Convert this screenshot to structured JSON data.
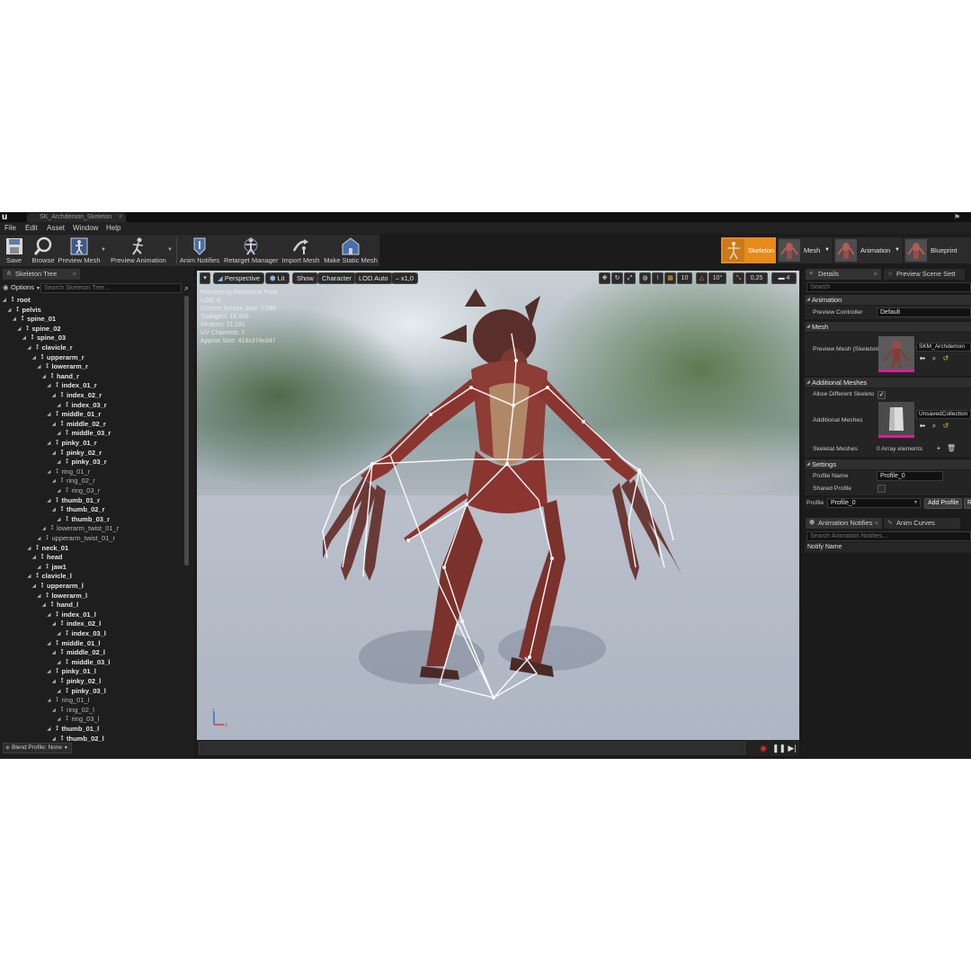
{
  "window": {
    "doc_tab": "SK_Archdemon_Skeleton"
  },
  "menu": [
    "File",
    "Edit",
    "Asset",
    "Window",
    "Help"
  ],
  "toolbar": {
    "save": "Save",
    "browse": "Browse",
    "preview_mesh": "Preview Mesh",
    "preview_animation": "Preview Animation",
    "anim_notifies": "Anim Notifies",
    "retarget_manager": "Retarget Manager",
    "import_mesh": "Import Mesh",
    "make_static_mesh": "Make Static Mesh"
  },
  "modes": {
    "skeleton": "Skeleton",
    "mesh": "Mesh",
    "animation": "Animation",
    "blueprint": "Blueprint"
  },
  "skeleton_tree": {
    "tab": "Skeleton Tree",
    "options": "Options",
    "search_placeholder": "Search Skeleton Tree...",
    "blend_profile": "Blend Profile: None",
    "bones": [
      {
        "name": "root",
        "depth": 0
      },
      {
        "name": "pelvis",
        "depth": 1
      },
      {
        "name": "spine_01",
        "depth": 2
      },
      {
        "name": "spine_02",
        "depth": 3
      },
      {
        "name": "spine_03",
        "depth": 4
      },
      {
        "name": "clavicle_r",
        "depth": 5
      },
      {
        "name": "upperarm_r",
        "depth": 6
      },
      {
        "name": "lowerarm_r",
        "depth": 7
      },
      {
        "name": "hand_r",
        "depth": 8
      },
      {
        "name": "index_01_r",
        "depth": 9
      },
      {
        "name": "index_02_r",
        "depth": 10
      },
      {
        "name": "index_03_r",
        "depth": 11
      },
      {
        "name": "middle_01_r",
        "depth": 9
      },
      {
        "name": "middle_02_r",
        "depth": 10
      },
      {
        "name": "middle_03_r",
        "depth": 11
      },
      {
        "name": "pinky_01_r",
        "depth": 9
      },
      {
        "name": "pinky_02_r",
        "depth": 10
      },
      {
        "name": "pinky_03_r",
        "depth": 11
      },
      {
        "name": "ring_01_r",
        "depth": 9
      },
      {
        "name": "ring_02_r",
        "depth": 10
      },
      {
        "name": "ring_03_r",
        "depth": 11
      },
      {
        "name": "thumb_01_r",
        "depth": 9
      },
      {
        "name": "thumb_02_r",
        "depth": 10
      },
      {
        "name": "thumb_03_r",
        "depth": 11
      },
      {
        "name": "lowerarm_twist_01_r",
        "depth": 8
      },
      {
        "name": "upperarm_twist_01_r",
        "depth": 7
      },
      {
        "name": "neck_01",
        "depth": 5
      },
      {
        "name": "head",
        "depth": 6
      },
      {
        "name": "jaw1",
        "depth": 7
      },
      {
        "name": "clavicle_l",
        "depth": 5
      },
      {
        "name": "upperarm_l",
        "depth": 6
      },
      {
        "name": "lowerarm_l",
        "depth": 7
      },
      {
        "name": "hand_l",
        "depth": 8
      },
      {
        "name": "index_01_l",
        "depth": 9
      },
      {
        "name": "index_02_l",
        "depth": 10
      },
      {
        "name": "index_03_l",
        "depth": 11
      },
      {
        "name": "middle_01_l",
        "depth": 9
      },
      {
        "name": "middle_02_l",
        "depth": 10
      },
      {
        "name": "middle_03_l",
        "depth": 11
      },
      {
        "name": "pinky_01_l",
        "depth": 9
      },
      {
        "name": "pinky_02_l",
        "depth": 10
      },
      {
        "name": "pinky_03_l",
        "depth": 11
      },
      {
        "name": "ring_01_l",
        "depth": 9
      },
      {
        "name": "ring_02_l",
        "depth": 10
      },
      {
        "name": "ring_03_l",
        "depth": 11
      },
      {
        "name": "thumb_01_l",
        "depth": 9
      },
      {
        "name": "thumb_02_l",
        "depth": 10
      }
    ]
  },
  "viewport": {
    "perspective": "Perspective",
    "lit": "Lit",
    "show": "Show",
    "character": "Character",
    "lod": "LOD Auto",
    "speed": "x1,0",
    "grid_size": "10",
    "rot_snap": "10°",
    "scale_snap": "0,25",
    "cam_speed": "4",
    "stats": [
      "Previewing Reference Pose",
      "LOD: 0",
      "Current Screen Size: 1,596",
      "Triangles: 18,906",
      "Vertices: 11,191",
      "UV Channels: 1",
      "Approx Size: 419x374x347"
    ]
  },
  "details": {
    "tab": "Details",
    "tab2": "Preview Scene Sett",
    "search_placeholder": "Search",
    "animation_cat": "Animation",
    "preview_controller_label": "Preview Controller",
    "preview_controller_value": "Default",
    "mesh_cat": "Mesh",
    "preview_mesh_label": "Preview Mesh (Skeleton)",
    "preview_mesh_value": "SKM_Archdemon",
    "additional_meshes_cat": "Additional Meshes",
    "allow_different_label": "Allow Different Skeleto",
    "additional_meshes_label": "Additional Meshes",
    "additional_meshes_value": "UnsavedCollection",
    "skeletal_meshes_label": "Skeletal Meshes",
    "skeletal_meshes_value": "0 Array elements",
    "settings_cat": "Settings",
    "profile_name_label": "Profile Name",
    "profile_name_value": "Profile_0",
    "shared_profile_label": "Shared Profile",
    "profile_label": "Profile",
    "profile_value": "Profile_0",
    "add_profile": "Add Profile",
    "remove_profile": "R"
  },
  "notifies": {
    "tab": "Animation Notifies",
    "tab2": "Anim Curves",
    "search_placeholder": "Search Animation Notifies...",
    "column": "Notify Name"
  }
}
